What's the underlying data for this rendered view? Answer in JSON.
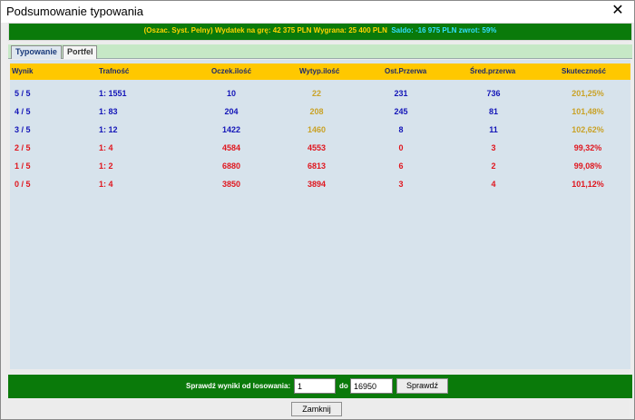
{
  "window": {
    "title": "Podsumowanie typowania",
    "close_glyph": "✕"
  },
  "summary": {
    "part1": "(Oszac. Syst. Pelny)  Wydatek na grę: 42 375 PLN  Wygrana: 25 400 PLN",
    "part2": "Saldo: -16 975 PLN   zwrot: 59%"
  },
  "tabs": [
    {
      "label": "Typowanie",
      "active": true
    },
    {
      "label": "Portfel",
      "active": false
    }
  ],
  "table": {
    "headers": [
      "Wynik",
      "Trafność",
      "Oczek.ilość",
      "Wytyp.ilość",
      "Ost.Przerwa",
      "Śred.przerwa",
      "Skuteczność"
    ],
    "rows": [
      {
        "color": "blue",
        "cells": [
          "5 / 5",
          "1: 1551",
          "10",
          "22",
          "231",
          "736",
          "201,25%"
        ]
      },
      {
        "color": "blue",
        "cells": [
          "4 / 5",
          "1: 83",
          "204",
          "208",
          "245",
          "81",
          "101,48%"
        ]
      },
      {
        "color": "blue",
        "cells": [
          "3 / 5",
          "1: 12",
          "1422",
          "1460",
          "8",
          "11",
          "102,62%"
        ]
      },
      {
        "color": "red",
        "cells": [
          "2 / 5",
          "1: 4",
          "4584",
          "4553",
          "0",
          "3",
          "99,32%"
        ]
      },
      {
        "color": "red",
        "cells": [
          "1 / 5",
          "1: 2",
          "6880",
          "6813",
          "6",
          "2",
          "99,08%"
        ]
      },
      {
        "color": "red",
        "cells": [
          "0 / 5",
          "1: 4",
          "3850",
          "3894",
          "3",
          "4",
          "101,12%"
        ]
      }
    ]
  },
  "check": {
    "label": "Sprawdź wyniki od losowania:",
    "from_value": "1",
    "to_label": "do",
    "to_value": "16950",
    "button_label": "Sprawdź"
  },
  "close_button_label": "Zamknij",
  "colors": {
    "green_bar": "#0a7a0a",
    "header_yellow": "#ffc800",
    "panel_bg": "#d7e3ec",
    "blue": "#1416b8",
    "gold": "#c9a227",
    "red": "#e0161e"
  }
}
